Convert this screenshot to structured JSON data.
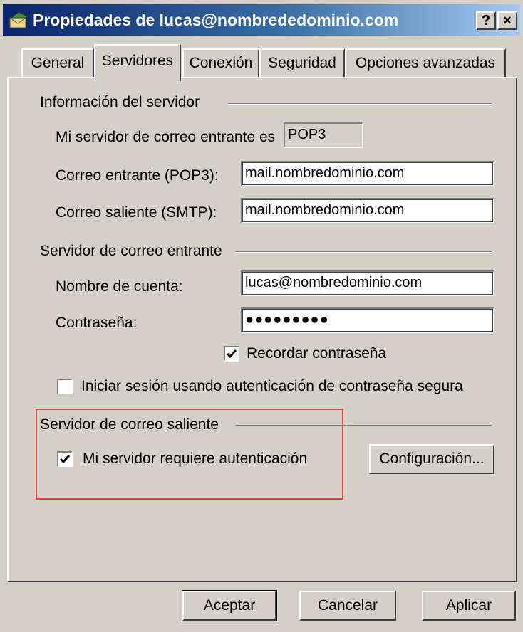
{
  "window": {
    "title": "Propiedades de lucas@nombrededominio.com",
    "help_label": "?",
    "close_label": "×"
  },
  "tabs": [
    {
      "label": "General"
    },
    {
      "label": "Servidores",
      "active": true
    },
    {
      "label": "Conexión"
    },
    {
      "label": "Seguridad"
    },
    {
      "label": "Opciones avanzadas"
    }
  ],
  "server_info": {
    "group_label": "Información del servidor",
    "incoming_type_label": "Mi servidor de correo entrante es",
    "incoming_type_value": "POP3",
    "incoming_label": "Correo entrante (POP3):",
    "incoming_value": "mail.nombredominio.com",
    "outgoing_label": "Correo saliente (SMTP):",
    "outgoing_value": "mail.nombredominio.com"
  },
  "incoming_server": {
    "group_label": "Servidor de correo entrante",
    "account_label": "Nombre de cuenta:",
    "account_value": "lucas@nombredominio.com",
    "password_label": "Contraseña:",
    "password_value": "●●●●●●●●●",
    "remember_label": "Recordar contraseña",
    "remember_checked": true,
    "spa_label": "Iniciar sesión usando autenticación de contraseña segura",
    "spa_checked": false
  },
  "outgoing_server": {
    "group_label": "Servidor de correo saliente",
    "auth_label": "Mi servidor requiere autenticación",
    "auth_checked": true,
    "settings_button": "Configuración..."
  },
  "footer": {
    "ok": "Aceptar",
    "cancel": "Cancelar",
    "apply": "Aplicar"
  },
  "colors": {
    "highlight": "#e04040",
    "titlebar_start": "#0a246a",
    "titlebar_end": "#a6caf0"
  }
}
